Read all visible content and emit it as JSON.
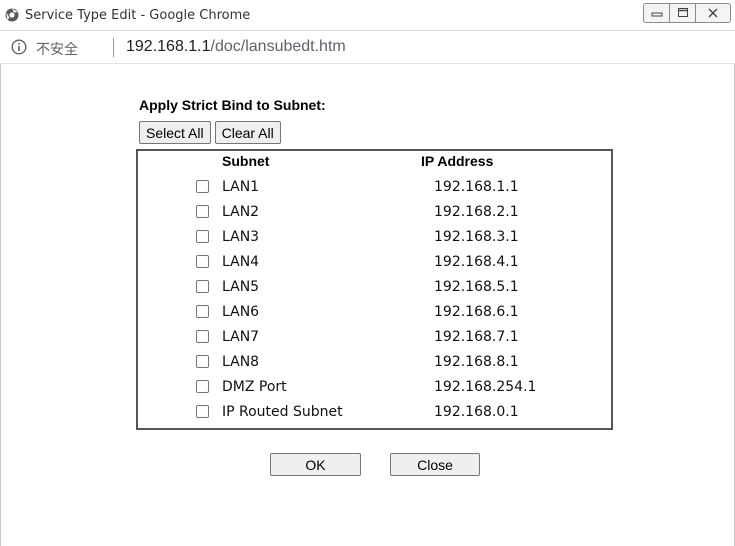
{
  "window": {
    "title": "Service Type Edit - Google Chrome"
  },
  "address": {
    "security_label": "不安全",
    "host": "192.168.1.1",
    "path": "/doc/lansubedt.htm"
  },
  "form": {
    "heading": "Apply Strict Bind to Subnet:",
    "select_all_label": "Select All",
    "clear_all_label": "Clear All",
    "columns": {
      "subnet": "Subnet",
      "ip": "IP Address"
    },
    "rows": [
      {
        "name": "LAN1",
        "ip": "192.168.1.1",
        "checked": false
      },
      {
        "name": "LAN2",
        "ip": "192.168.2.1",
        "checked": false
      },
      {
        "name": "LAN3",
        "ip": "192.168.3.1",
        "checked": false
      },
      {
        "name": "LAN4",
        "ip": "192.168.4.1",
        "checked": false
      },
      {
        "name": "LAN5",
        "ip": "192.168.5.1",
        "checked": false
      },
      {
        "name": "LAN6",
        "ip": "192.168.6.1",
        "checked": false
      },
      {
        "name": "LAN7",
        "ip": "192.168.7.1",
        "checked": false
      },
      {
        "name": "LAN8",
        "ip": "192.168.8.1",
        "checked": false
      },
      {
        "name": "DMZ Port",
        "ip": "192.168.254.1",
        "checked": false
      },
      {
        "name": "IP Routed Subnet",
        "ip": "192.168.0.1",
        "checked": false
      }
    ],
    "ok_label": "OK",
    "close_label": "Close"
  },
  "colors": {
    "panel_border": "#555555",
    "button_bg": "#efefef"
  }
}
